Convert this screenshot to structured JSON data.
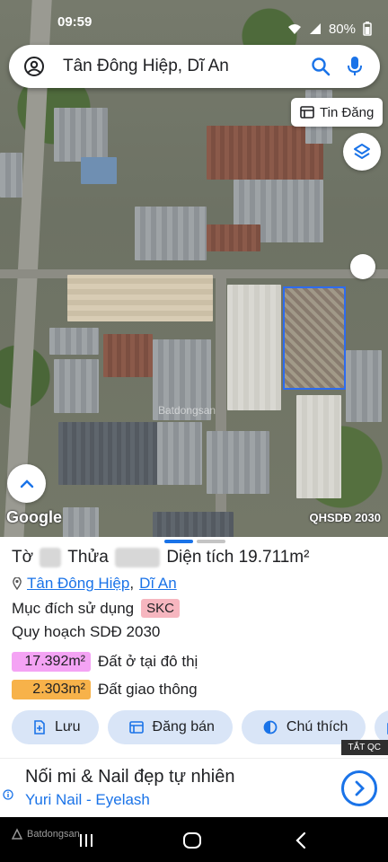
{
  "status_bar": {
    "time": "09:59",
    "battery": "80%"
  },
  "search": {
    "query": "Tân Đông Hiệp, Dĩ An"
  },
  "map": {
    "listing_button": "Tin Đăng",
    "watermark": "Batdongsan",
    "attribution": "Google",
    "layer_code": "QHSDĐ 2030",
    "plot_outline_color": "#2d6cf0"
  },
  "sheet": {
    "title_prefix": "Tờ",
    "title_parcel": "Thửa",
    "area_label": "Diện tích",
    "area_value": "19.711m²",
    "ward": "Tân Đông Hiệp",
    "separator": ",",
    "city": "Dĩ An",
    "purpose_label": "Mục đích sử dụng",
    "purpose_code": "SKC",
    "plan_title": "Quy hoạch SDĐ 2030",
    "plan_items": [
      {
        "area": "17.392m²",
        "label": "Đất ở tại đô thị",
        "color": "#f4a3f4"
      },
      {
        "area": "2.303m²",
        "label": "Đất giao thông",
        "color": "#f7b24a"
      }
    ],
    "actions": [
      {
        "label": "Lưu",
        "icon": "save-icon"
      },
      {
        "label": "Đăng bán",
        "icon": "listing-icon"
      },
      {
        "label": "Chú thích",
        "icon": "legend-icon"
      }
    ],
    "hide_ads": "TẮT QC"
  },
  "ad": {
    "title": "Nối mi & Nail đẹp tự nhiên",
    "subtitle": "Yuri Nail - Eyelash"
  },
  "nav": {
    "logo": "Batdongsan"
  },
  "colors": {
    "accent": "#1a73e8",
    "button_bg": "#d9e5f7",
    "handle_active": "#1a73e8",
    "handle_inactive": "#c4c4c4"
  }
}
